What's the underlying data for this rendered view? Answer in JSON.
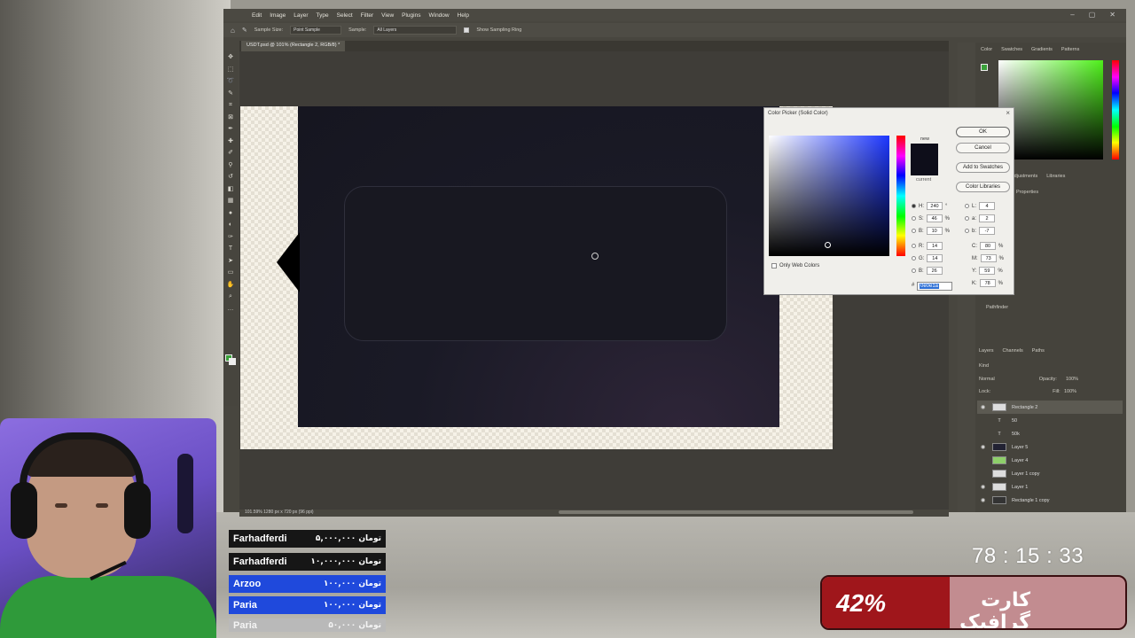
{
  "photoshop": {
    "menu": [
      "Edit",
      "Image",
      "Layer",
      "Type",
      "Select",
      "Filter",
      "View",
      "Plugins",
      "Window",
      "Help"
    ],
    "options_bar": {
      "sample_size_label": "Sample Size:",
      "sample_size_value": "Point Sample",
      "sample_label": "Sample:",
      "sample_value": "All Layers",
      "show_ring_label": "Show Sampling Ring"
    },
    "doc_tab": "USDT.psd @ 101% (Rectangle 2, RGB/8) *",
    "status": "101.59%    1280 px x 720 px (96 ppi)",
    "panel_tabs": [
      "Color",
      "Swatches",
      "Gradients",
      "Patterns"
    ],
    "mid_panel_tabs": [
      "Adjustments",
      "Libraries"
    ],
    "properties_label": "Properties",
    "pathfinder_label": "Pathfinder",
    "layer_tabs": [
      "Layers",
      "Channels",
      "Paths"
    ],
    "layers_controls": {
      "kind": "Kind",
      "blend": "Normal",
      "opacity_label": "Opacity:",
      "opacity_value": "100%",
      "lock_label": "Lock:",
      "fill_label": "Fill:",
      "fill_value": "100%"
    },
    "layers": [
      {
        "name": "Rectangle 2",
        "visible": true,
        "selected": true
      },
      {
        "name": "50",
        "visible": false,
        "selected": false
      },
      {
        "name": "50k",
        "visible": false,
        "selected": false
      },
      {
        "name": "Layer 5",
        "visible": true,
        "selected": false
      },
      {
        "name": "Layer 4",
        "visible": false,
        "selected": false
      },
      {
        "name": "Layer 1 copy",
        "visible": false,
        "selected": false
      },
      {
        "name": "Layer 1",
        "visible": true,
        "selected": false
      },
      {
        "name": "Rectangle 1 copy",
        "visible": true,
        "selected": false
      }
    ]
  },
  "color_picker": {
    "title": "Color Picker (Solid Color)",
    "ok": "OK",
    "cancel": "Cancel",
    "add_to_swatches": "Add to Swatches",
    "color_libraries": "Color Libraries",
    "new_label": "new",
    "current_label": "current",
    "only_web_colors": "Only Web Colors",
    "fields": {
      "H": "240",
      "S": "46",
      "B": "10",
      "R": "14",
      "G": "14",
      "Bl": "26",
      "L": "4",
      "a": "2",
      "b": "-7",
      "C": "80",
      "M": "73",
      "Y": "59",
      "K": "78"
    },
    "hex": "0e0e1a",
    "selected_color": "#0e0e1a"
  },
  "donations": [
    {
      "name": "Farhadferdi",
      "amount": "۵,۰۰۰,۰۰۰ تومان",
      "style": "dark"
    },
    {
      "name": "Farhadferdi",
      "amount": "۱۰,۰۰۰,۰۰۰ تومان",
      "style": "dark"
    },
    {
      "name": "Arzoo",
      "amount": "۱۰۰,۰۰۰ تومان",
      "style": "blue"
    },
    {
      "name": "Paria",
      "amount": "۱۰۰,۰۰۰ تومان",
      "style": "blue"
    },
    {
      "name": "Paria",
      "amount": "۵۰,۰۰۰ تومان",
      "style": "grey"
    }
  ],
  "timer": "78 : 15 : 33",
  "goal": {
    "percent_text": "42%",
    "percent": 42,
    "label": "کارت گرافیک"
  }
}
